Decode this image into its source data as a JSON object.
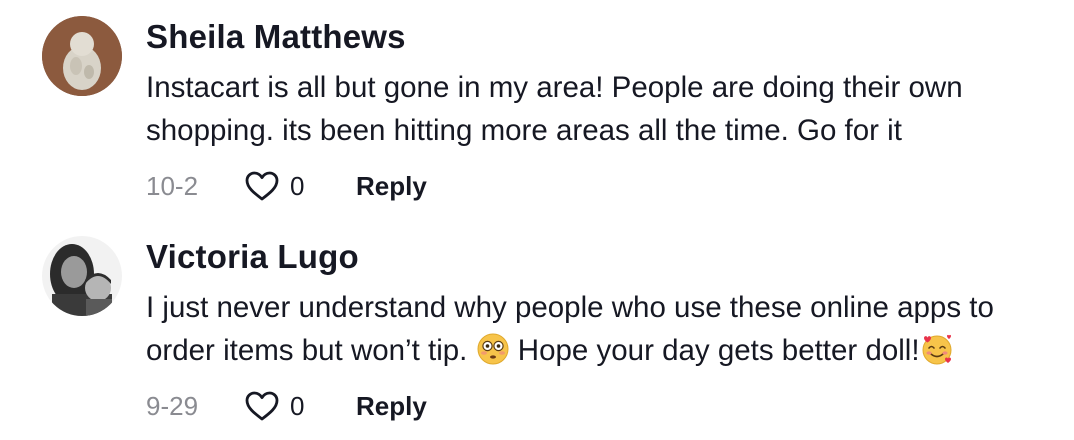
{
  "comments": [
    {
      "username": "Sheila Matthews",
      "text": "Instacart is all but gone in my area! People are doing their own shopping. its been hitting more areas all the time. Go for it",
      "date": "10-2",
      "likes": "0",
      "reply_label": "Reply"
    },
    {
      "username": "Victoria Lugo",
      "text_part1": "I just never understand why people who use these online apps to order items but won’t tip.",
      "text_part2": "Hope your day gets better doll!",
      "date": "9-29",
      "likes": "0",
      "reply_label": "Reply",
      "emojis": [
        "flushed-face-emoji",
        "smiling-face-with-hearts-emoji"
      ]
    }
  ],
  "colors": {
    "text": "#161823",
    "muted": "#8a8b91",
    "background": "#ffffff"
  }
}
